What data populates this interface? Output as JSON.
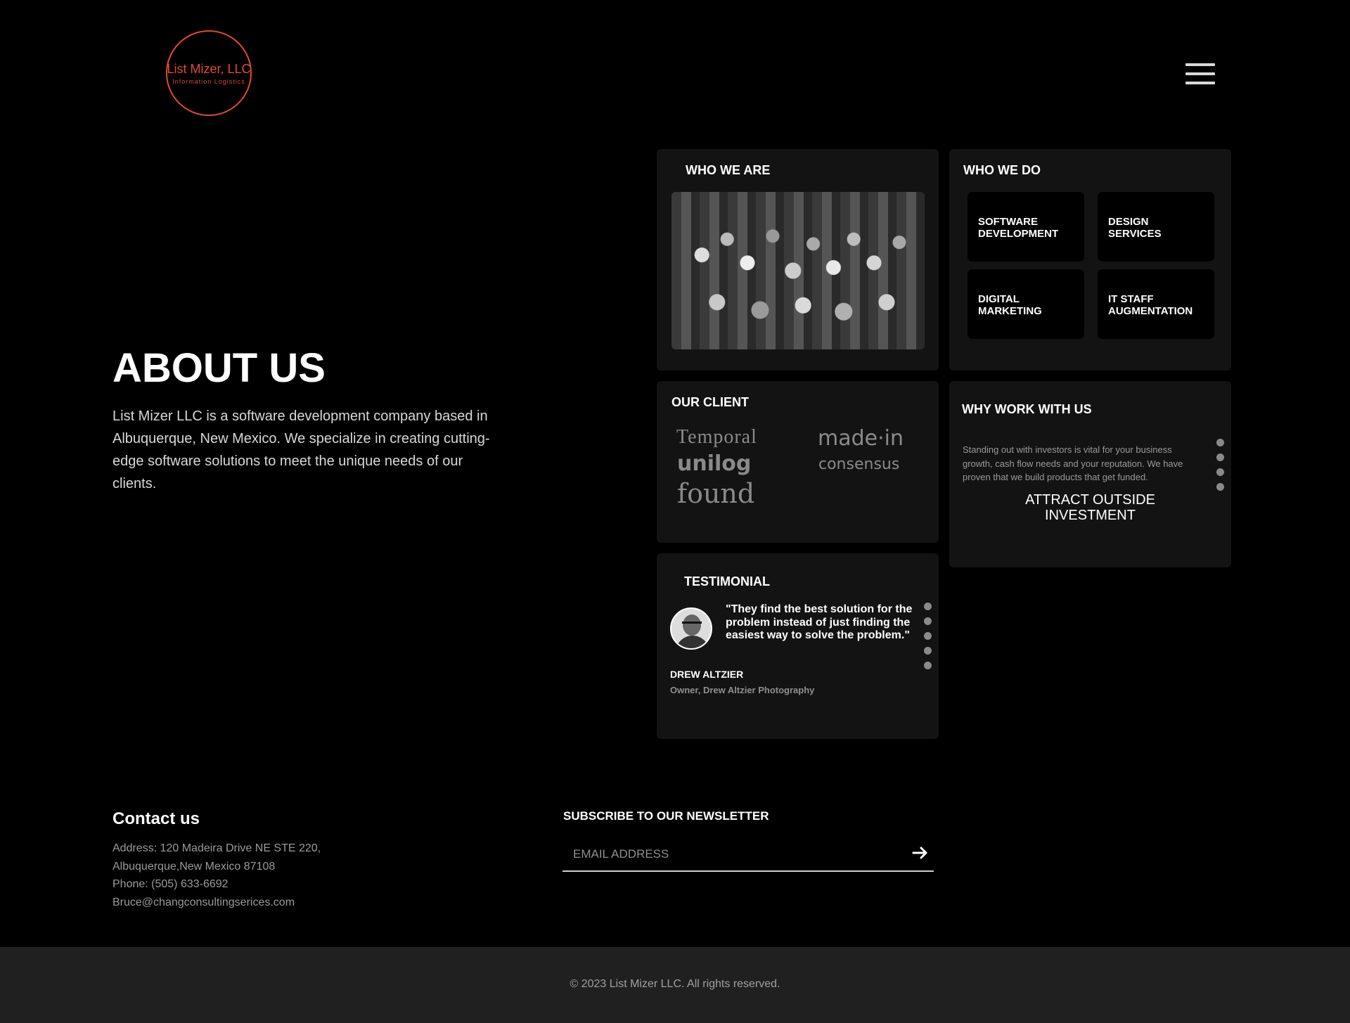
{
  "header": {
    "logo_name": "List Mizer, LLC",
    "logo_tagline": "Information Logistics",
    "menu_icon": "hamburger-menu-icon"
  },
  "about": {
    "title": "ABOUT US",
    "text": "List Mizer LLC is a software development company based in Albuquerque, New Mexico. We specialize in creating cutting-edge software solutions to meet the unique needs of our clients."
  },
  "who_we_are": {
    "title": "WHO WE ARE"
  },
  "who_we_do": {
    "title": "WHO WE DO",
    "services": [
      {
        "label": "SOFTWARE DEVELOPMENT"
      },
      {
        "label": "DESIGN SERVICES"
      },
      {
        "label": "DIGITAL MARKETING"
      },
      {
        "label": "IT STAFF AUGMENTATION"
      }
    ]
  },
  "clients": {
    "title": "OUR CLIENT",
    "logos": [
      "Temporal",
      "made·in",
      "unilog",
      "consensus",
      "found"
    ]
  },
  "why": {
    "title": "WHY WORK WITH US",
    "text": "Standing out with investors is vital for your business growth, cash flow needs and your reputation. We have proven that we build products that get funded.",
    "heading_line1": "ATTRACT OUTSIDE",
    "heading_line2": "INVESTMENT"
  },
  "testimonial": {
    "title": "TESTIMONIAL",
    "quote": "\"They find the best solution for the problem instead of just finding the easiest way to solve the problem.\"",
    "name": "DREW ALTZIER",
    "role": "Owner, Drew Altzier Photography"
  },
  "contact": {
    "title": "Contact us",
    "address_line1": "Address: 120 Madeira Drive NE STE 220,",
    "address_line2": "Albuquerque,New Mexico 87108",
    "phone": "Phone: (505) 633-6692",
    "email": "Bruce@changconsultingserices.com"
  },
  "newsletter": {
    "title": "SUBSCRIBE TO OUR NEWSLETTER",
    "placeholder": "EMAIL ADDRESS",
    "value": ""
  },
  "footer": {
    "copyright": "© 2023 List Mizer LLC. All rights reserved."
  },
  "colors": {
    "brand": "#e14a32",
    "card": "#131313",
    "background": "#000000",
    "footer_bar": "#202020"
  }
}
